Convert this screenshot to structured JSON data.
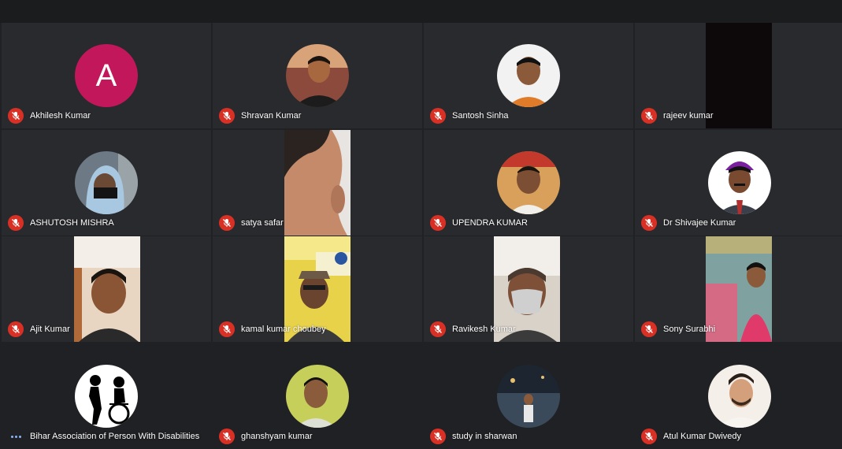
{
  "participants": [
    {
      "name": "Akhilesh Kumar",
      "initial": "A"
    },
    {
      "name": "Shravan Kumar"
    },
    {
      "name": "Santosh Sinha"
    },
    {
      "name": "rajeev kumar"
    },
    {
      "name": "ASHUTOSH MISHRA"
    },
    {
      "name": "satya safar"
    },
    {
      "name": "UPENDRA KUMAR"
    },
    {
      "name": "Dr Shivajee Kumar"
    },
    {
      "name": "Ajit Kumar"
    },
    {
      "name": "kamal kumar choubey"
    },
    {
      "name": "Ravikesh Kumar"
    },
    {
      "name": "Sony Surabhi"
    },
    {
      "name": "Bihar Association of Person With Disabilities"
    },
    {
      "name": "ghanshyam kumar"
    },
    {
      "name": "study in sharwan"
    },
    {
      "name": "Atul Kumar Dwivedy"
    }
  ],
  "colors": {
    "background": "#202124",
    "tile": "#292a2d",
    "muted_badge": "#d93025",
    "speaking_indicator": "#8ab4f8",
    "letter_avatar": "#c2185b"
  },
  "icons": {
    "muted": "mic-off-icon",
    "speaking": "audio-dots-icon"
  }
}
